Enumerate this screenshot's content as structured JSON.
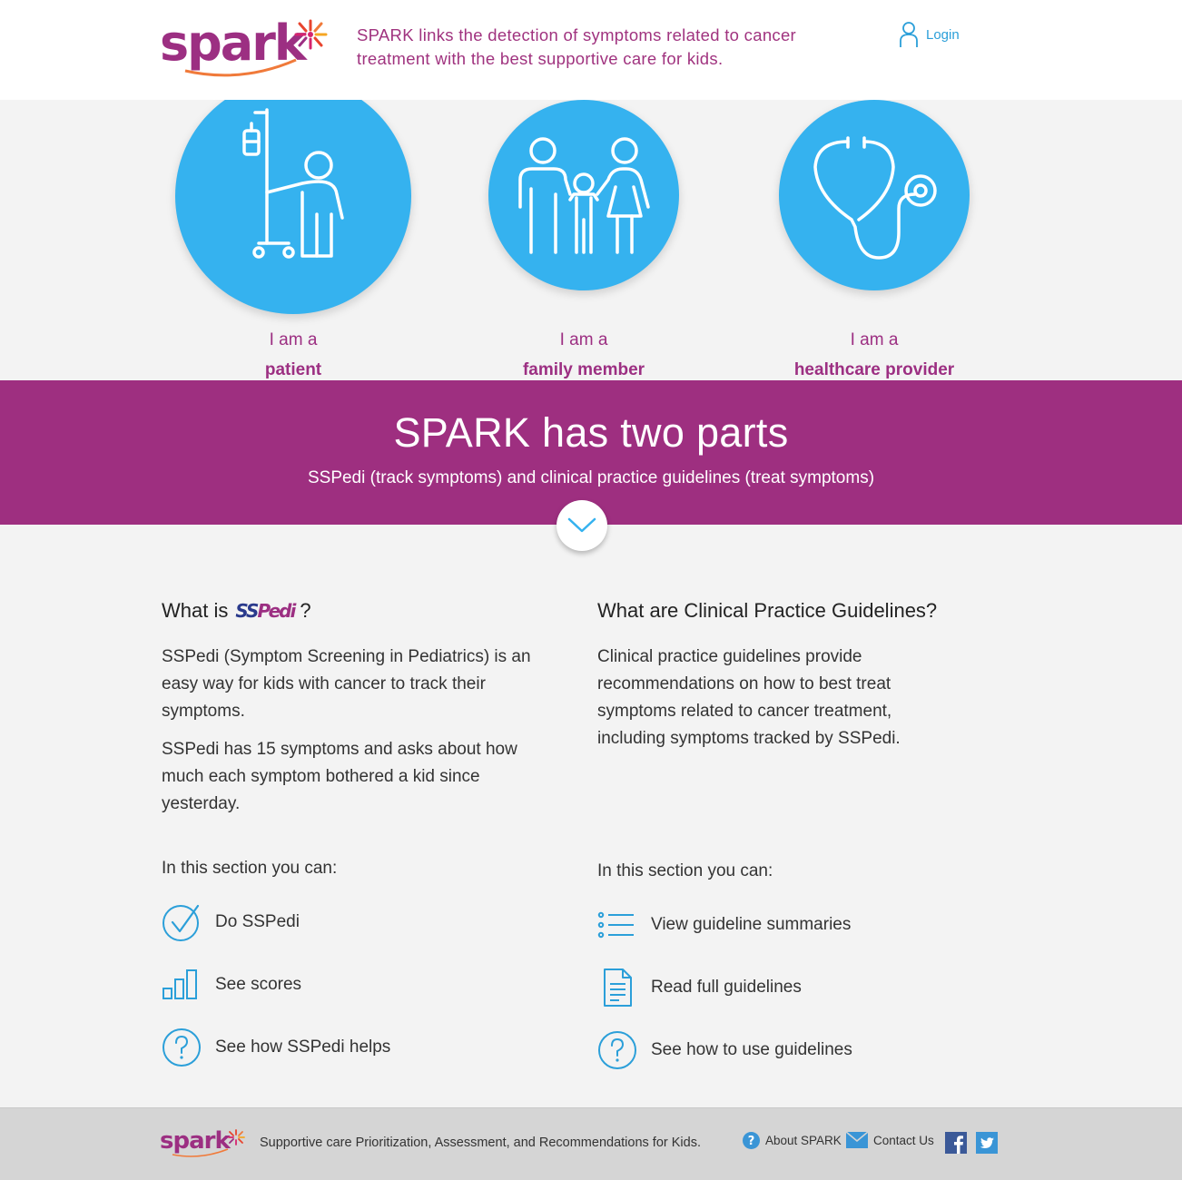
{
  "header": {
    "logo_text": "spark",
    "tagline": "SPARK links the detection of symptoms related to cancer treatment with the best supportive care for kids.",
    "login_label": "Login"
  },
  "roles": [
    {
      "pre": "I am a",
      "main": "patient",
      "icon": "patient-iv-icon"
    },
    {
      "pre": "I am a",
      "main": "family member",
      "icon": "family-icon"
    },
    {
      "pre": "I am a",
      "main": "healthcare provider",
      "icon": "stethoscope-icon"
    }
  ],
  "banner": {
    "title": "SPARK has two parts",
    "subtitle": "SSPedi (track symptoms) and clinical practice guidelines (treat symptoms)"
  },
  "sspedi": {
    "heading_pre": "What is",
    "logo_ss": "SS",
    "logo_pedi": "Pedi",
    "heading_post": "?",
    "para1": "SSPedi (Symptom Screening in Pediatrics) is an easy way for kids with cancer to track their symptoms.",
    "para2": "SSPedi has 15 symptoms and asks about how much each symptom bothered a kid since yesterday.",
    "section_label": "In this section you can:",
    "actions": [
      {
        "label": "Do SSPedi",
        "icon": "checkmark-circle-icon"
      },
      {
        "label": "See scores",
        "icon": "bar-chart-icon"
      },
      {
        "label": "See how SSPedi helps",
        "icon": "question-circle-icon"
      }
    ]
  },
  "guidelines": {
    "heading": "What are Clinical Practice Guidelines?",
    "para1": "Clinical practice guidelines provide recommendations on how to best treat symptoms related to cancer treatment, including symptoms tracked by SSPedi.",
    "section_label": "In this section you can:",
    "actions": [
      {
        "label": "View guideline summaries",
        "icon": "list-icon"
      },
      {
        "label": "Read full guidelines",
        "icon": "document-icon"
      },
      {
        "label": "See how to use guidelines",
        "icon": "question-circle-icon"
      }
    ]
  },
  "footer": {
    "logo_text": "spark",
    "tagline": "Supportive care Prioritization, Assessment, and Recommendations for Kids.",
    "about_label": "About SPARK",
    "contact_label": "Contact Us"
  },
  "colors": {
    "brand_purple": "#9e2f80",
    "accent_blue": "#35b2ef",
    "link_blue": "#2b9fd9"
  }
}
